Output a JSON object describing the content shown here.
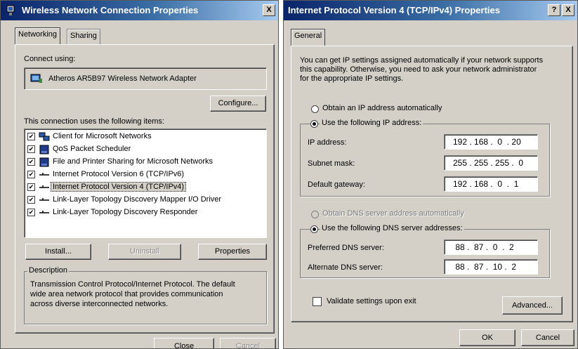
{
  "left_dialog": {
    "title": "Wireless Network Connection Properties",
    "close_glyph": "X",
    "tabs": [
      "Networking",
      "Sharing"
    ],
    "connect_using_label": "Connect using:",
    "adapter_name": "Atheros AR5B97 Wireless Network Adapter",
    "configure_label": "Configure...",
    "items_label": "This connection uses the following items:",
    "items": [
      {
        "label": "Client for Microsoft Networks",
        "checked": true,
        "icon": "network-client-icon"
      },
      {
        "label": "QoS Packet Scheduler",
        "checked": true,
        "icon": "service-icon"
      },
      {
        "label": "File and Printer Sharing for Microsoft Networks",
        "checked": true,
        "icon": "service-icon"
      },
      {
        "label": "Internet Protocol Version 6 (TCP/IPv6)",
        "checked": true,
        "icon": "protocol-icon"
      },
      {
        "label": "Internet Protocol Version 4 (TCP/IPv4)",
        "checked": true,
        "icon": "protocol-icon",
        "selected": true
      },
      {
        "label": "Link-Layer Topology Discovery Mapper I/O Driver",
        "checked": true,
        "icon": "protocol-icon"
      },
      {
        "label": "Link-Layer Topology Discovery Responder",
        "checked": true,
        "icon": "protocol-icon"
      }
    ],
    "install_label": "Install...",
    "uninstall_label": "Uninstall",
    "properties_label": "Properties",
    "description_title": "Description",
    "description_lines": [
      "Transmission Control Protocol/Internet Protocol. The default",
      "wide area network protocol that provides communication",
      "across diverse interconnected networks."
    ],
    "close_label": "Close",
    "cancel_label": "Cancel"
  },
  "right_dialog": {
    "title": "Internet Protocol Version 4 (TCP/IPv4) Properties",
    "help_glyph": "?",
    "close_glyph": "X",
    "tab_general": "General",
    "intro_lines": [
      "You can get IP settings assigned automatically if your network supports",
      "this capability. Otherwise, you need to ask your network administrator",
      "for the appropriate IP settings."
    ],
    "obtain_ip_auto": "Obtain an IP address automatically",
    "use_following_ip": "Use the following IP address:",
    "ip_address_label": "IP address:",
    "ip_address_value": "192 . 168 .  0  . 20",
    "subnet_label": "Subnet mask:",
    "subnet_value": "255 . 255 . 255 .  0",
    "gateway_label": "Default gateway:",
    "gateway_value": "192 . 168 .  0  .  1",
    "obtain_dns_auto": "Obtain DNS server address automatically",
    "use_following_dns": "Use the following DNS server addresses:",
    "preferred_dns_label": "Preferred DNS server:",
    "preferred_dns_value": " 88 .  87 .  0  .  2",
    "alternate_dns_label": "Alternate DNS server:",
    "alternate_dns_value": " 88 .  87 .  10 .  2",
    "validate_label": "Validate settings upon exit",
    "advanced_label": "Advanced...",
    "ok_label": "OK",
    "cancel_label": "Cancel",
    "ip_mode": "manual",
    "dns_mode": "manual",
    "validate_checked": false
  }
}
